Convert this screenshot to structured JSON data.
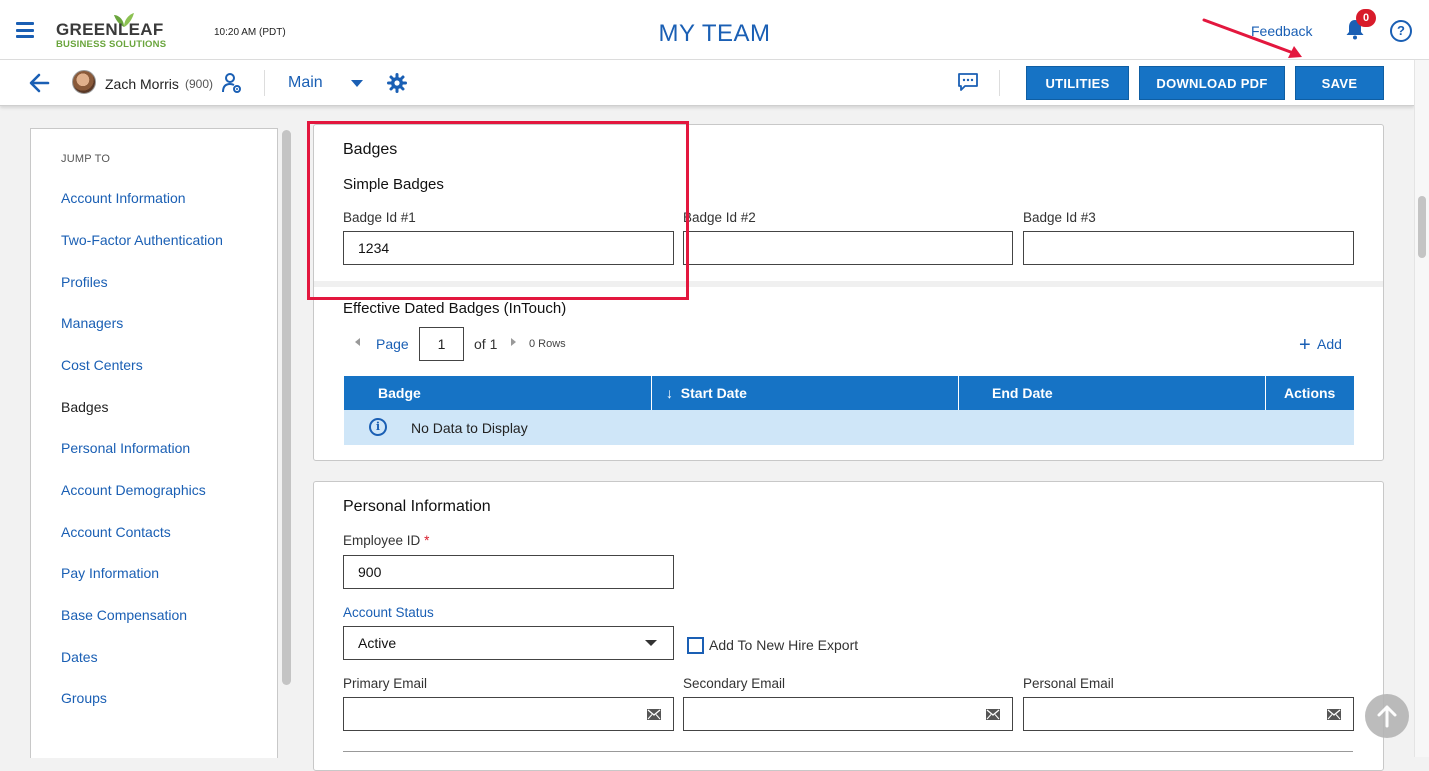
{
  "header": {
    "logo_main": "GREENLEAF",
    "logo_sub": "BUSINESS SOLUTIONS",
    "clock": "10:20 AM (PDT)",
    "page_title": "MY TEAM",
    "feedback": "Feedback",
    "notification_count": "0",
    "help": "?"
  },
  "toolbar": {
    "user_name": "Zach Morris",
    "user_id": "(900)",
    "view": "Main",
    "buttons": [
      "UTILITIES",
      "DOWNLOAD PDF",
      "SAVE"
    ]
  },
  "sidebar": {
    "jump_to": "JUMP TO",
    "items": [
      {
        "label": "Account Information",
        "active": false
      },
      {
        "label": "Two-Factor Authentication",
        "active": false
      },
      {
        "label": "Profiles",
        "active": false
      },
      {
        "label": "Managers",
        "active": false
      },
      {
        "label": "Cost Centers",
        "active": false
      },
      {
        "label": "Badges",
        "active": true
      },
      {
        "label": "Personal Information",
        "active": false
      },
      {
        "label": "Account Demographics",
        "active": false
      },
      {
        "label": "Account Contacts",
        "active": false
      },
      {
        "label": "Pay Information",
        "active": false
      },
      {
        "label": "Base Compensation",
        "active": false
      },
      {
        "label": "Dates",
        "active": false
      },
      {
        "label": "Groups",
        "active": false
      }
    ]
  },
  "badges": {
    "title": "Badges",
    "simple_title": "Simple Badges",
    "fields": [
      {
        "label": "Badge Id #1",
        "value": "1234"
      },
      {
        "label": "Badge Id #2",
        "value": ""
      },
      {
        "label": "Badge Id #3",
        "value": ""
      }
    ],
    "effective_title": "Effective Dated Badges (InTouch)",
    "pager": {
      "page_label": "Page",
      "page": "1",
      "of": "of 1",
      "rows": "0 Rows"
    },
    "add_label": "Add",
    "columns": [
      "Badge",
      "Start Date",
      "End Date",
      "Actions"
    ],
    "sort_arrow": "↓",
    "empty_text": "No Data to Display"
  },
  "personal": {
    "title": "Personal Information",
    "employee_id_label": "Employee ID",
    "required_mark": "*",
    "employee_id": "900",
    "status_label": "Account Status",
    "status_value": "Active",
    "hire_export_label": "Add To New Hire Export",
    "hire_export_checked": false,
    "emails": [
      {
        "label": "Primary Email",
        "value": ""
      },
      {
        "label": "Secondary Email",
        "value": ""
      },
      {
        "label": "Personal Email",
        "value": ""
      }
    ]
  },
  "colors": {
    "brand_blue": "#1a5fb4",
    "button_blue": "#1673c5",
    "highlight_red": "#e3173e",
    "badge_red": "#d81b2b",
    "logo_green": "#6aa53d"
  }
}
